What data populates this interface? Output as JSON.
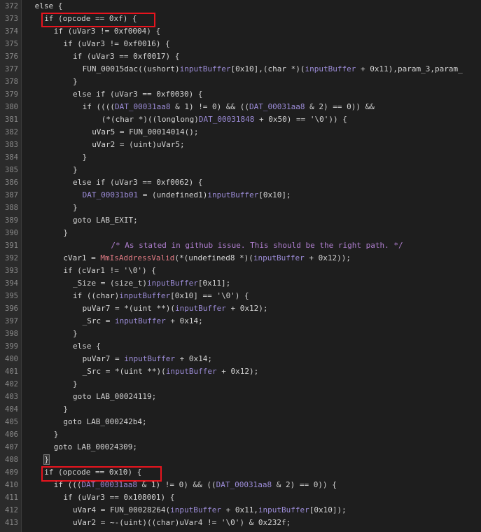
{
  "editor": {
    "lines": [
      {
        "n": "372",
        "i": 1,
        "t": [
          [
            "k",
            "else"
          ],
          [
            "p",
            " {"
          ]
        ]
      },
      {
        "n": "373",
        "i": 2,
        "t": [
          [
            "k",
            "if"
          ],
          [
            "p",
            " (opcode == 0xf) {"
          ]
        ],
        "box": "box1"
      },
      {
        "n": "374",
        "i": 3,
        "t": [
          [
            "k",
            "if"
          ],
          [
            "p",
            " (uVar3 != 0xf0004) {"
          ]
        ]
      },
      {
        "n": "375",
        "i": 4,
        "t": [
          [
            "k",
            "if"
          ],
          [
            "p",
            " (uVar3 != 0xf0016) {"
          ]
        ]
      },
      {
        "n": "376",
        "i": 5,
        "t": [
          [
            "k",
            "if"
          ],
          [
            "p",
            " (uVar3 == 0xf0017) {"
          ]
        ]
      },
      {
        "n": "377",
        "i": 6,
        "t": [
          [
            "f",
            "FUN_00015dac"
          ],
          [
            "p",
            "((ushort)"
          ],
          [
            "gl",
            "inputBuffer"
          ],
          [
            "p",
            "[0x10],(char *)("
          ],
          [
            "gl",
            "inputBuffer"
          ],
          [
            "p",
            " + 0x11),param_3,param_"
          ]
        ]
      },
      {
        "n": "378",
        "i": 5,
        "t": [
          [
            "p",
            "}"
          ]
        ]
      },
      {
        "n": "379",
        "i": 5,
        "t": [
          [
            "k",
            "else if"
          ],
          [
            "p",
            " (uVar3 == 0xf0030) {"
          ]
        ]
      },
      {
        "n": "380",
        "i": 6,
        "t": [
          [
            "k",
            "if"
          ],
          [
            "p",
            " (((("
          ],
          [
            "gl",
            "DAT_00031aa8"
          ],
          [
            "p",
            " & 1) != 0) && (("
          ],
          [
            "gl",
            "DAT_00031aa8"
          ],
          [
            "p",
            " & 2) == 0)) &&"
          ]
        ]
      },
      {
        "n": "381",
        "i": 8,
        "t": [
          [
            "p",
            "(*(char *)((longlong)"
          ],
          [
            "gl",
            "DAT_00031848"
          ],
          [
            "p",
            " + 0x50) == '\\0')) {"
          ]
        ]
      },
      {
        "n": "382",
        "i": 7,
        "t": [
          [
            "p",
            "uVar5 = "
          ],
          [
            "f",
            "FUN_00014014"
          ],
          [
            "p",
            "();"
          ]
        ]
      },
      {
        "n": "383",
        "i": 7,
        "t": [
          [
            "p",
            "uVar2 = (uint)uVar5;"
          ]
        ]
      },
      {
        "n": "384",
        "i": 6,
        "t": [
          [
            "p",
            "}"
          ]
        ]
      },
      {
        "n": "385",
        "i": 5,
        "t": [
          [
            "p",
            "}"
          ]
        ]
      },
      {
        "n": "386",
        "i": 5,
        "t": [
          [
            "k",
            "else if"
          ],
          [
            "p",
            " (uVar3 == 0xf0062) {"
          ]
        ]
      },
      {
        "n": "387",
        "i": 6,
        "t": [
          [
            "gl",
            "DAT_00031b01"
          ],
          [
            "p",
            " = (undefined1)"
          ],
          [
            "gl",
            "inputBuffer"
          ],
          [
            "p",
            "[0x10];"
          ]
        ]
      },
      {
        "n": "388",
        "i": 5,
        "t": [
          [
            "p",
            "}"
          ]
        ]
      },
      {
        "n": "389",
        "i": 5,
        "t": [
          [
            "k",
            "goto"
          ],
          [
            "p",
            " LAB_EXIT;"
          ]
        ]
      },
      {
        "n": "390",
        "i": 4,
        "t": [
          [
            "p",
            "}"
          ]
        ]
      },
      {
        "n": "391",
        "i": 9,
        "t": [
          [
            "cm",
            "/* As stated in github issue. This should be the right path. */"
          ]
        ]
      },
      {
        "n": "392",
        "i": 4,
        "t": [
          [
            "p",
            "cVar1 = "
          ],
          [
            "api",
            "MmIsAddressValid"
          ],
          [
            "p",
            "(*(undefined8 *)("
          ],
          [
            "gl",
            "inputBuffer"
          ],
          [
            "p",
            " + 0x12));"
          ]
        ]
      },
      {
        "n": "393",
        "i": 4,
        "t": [
          [
            "k",
            "if"
          ],
          [
            "p",
            " (cVar1 != '\\0') {"
          ]
        ]
      },
      {
        "n": "394",
        "i": 5,
        "t": [
          [
            "p",
            "_Size = (size_t)"
          ],
          [
            "gl",
            "inputBuffer"
          ],
          [
            "p",
            "[0x11];"
          ]
        ]
      },
      {
        "n": "395",
        "i": 5,
        "t": [
          [
            "k",
            "if"
          ],
          [
            "p",
            " ((char)"
          ],
          [
            "gl",
            "inputBuffer"
          ],
          [
            "p",
            "[0x10] == '\\0') {"
          ]
        ]
      },
      {
        "n": "396",
        "i": 6,
        "t": [
          [
            "p",
            "puVar7 = *(uint **)("
          ],
          [
            "gl",
            "inputBuffer"
          ],
          [
            "p",
            " + 0x12);"
          ]
        ]
      },
      {
        "n": "397",
        "i": 6,
        "t": [
          [
            "p",
            "_Src = "
          ],
          [
            "gl",
            "inputBuffer"
          ],
          [
            "p",
            " + 0x14;"
          ]
        ]
      },
      {
        "n": "398",
        "i": 5,
        "t": [
          [
            "p",
            "}"
          ]
        ]
      },
      {
        "n": "399",
        "i": 5,
        "t": [
          [
            "k",
            "else"
          ],
          [
            "p",
            " {"
          ]
        ]
      },
      {
        "n": "400",
        "i": 6,
        "t": [
          [
            "p",
            "puVar7 = "
          ],
          [
            "gl",
            "inputBuffer"
          ],
          [
            "p",
            " + 0x14;"
          ]
        ]
      },
      {
        "n": "401",
        "i": 6,
        "t": [
          [
            "p",
            "_Src = *(uint **)("
          ],
          [
            "gl",
            "inputBuffer"
          ],
          [
            "p",
            " + 0x12);"
          ]
        ]
      },
      {
        "n": "402",
        "i": 5,
        "t": [
          [
            "p",
            "}"
          ]
        ]
      },
      {
        "n": "403",
        "i": 5,
        "t": [
          [
            "k",
            "goto"
          ],
          [
            "p",
            " LAB_00024119;"
          ]
        ]
      },
      {
        "n": "404",
        "i": 4,
        "t": [
          [
            "p",
            "}"
          ]
        ]
      },
      {
        "n": "405",
        "i": 4,
        "t": [
          [
            "k",
            "goto"
          ],
          [
            "p",
            " LAB_000242b4;"
          ]
        ]
      },
      {
        "n": "406",
        "i": 3,
        "t": [
          [
            "p",
            "}"
          ]
        ]
      },
      {
        "n": "407",
        "i": 3,
        "t": [
          [
            "k",
            "goto"
          ],
          [
            "p",
            " LAB_00024309;"
          ]
        ]
      },
      {
        "n": "408",
        "i": 2,
        "t": [
          [
            "c",
            "}"
          ]
        ]
      },
      {
        "n": "409",
        "i": 2,
        "t": [
          [
            "k",
            "if"
          ],
          [
            "p",
            " (opcode == 0x10) {"
          ]
        ],
        "box": "box2"
      },
      {
        "n": "410",
        "i": 3,
        "t": [
          [
            "k",
            "if"
          ],
          [
            "p",
            " ((("
          ],
          [
            "gl",
            "DAT_00031aa8"
          ],
          [
            "p",
            " & 1) != 0) && (("
          ],
          [
            "gl",
            "DAT_00031aa8"
          ],
          [
            "p",
            " & 2) == 0)) {"
          ]
        ]
      },
      {
        "n": "411",
        "i": 4,
        "t": [
          [
            "k",
            "if"
          ],
          [
            "p",
            " (uVar3 == 0x108001) {"
          ]
        ]
      },
      {
        "n": "412",
        "i": 5,
        "t": [
          [
            "p",
            "uVar4 = "
          ],
          [
            "f",
            "FUN_00028264"
          ],
          [
            "p",
            "("
          ],
          [
            "gl",
            "inputBuffer"
          ],
          [
            "p",
            " + 0x11,"
          ],
          [
            "gl",
            "inputBuffer"
          ],
          [
            "p",
            "[0x10]);"
          ]
        ]
      },
      {
        "n": "413",
        "i": 5,
        "t": [
          [
            "p",
            "uVar2 = ~-(uint)((char)uVar4 != '\\0') & 0x232f;"
          ]
        ]
      }
    ]
  },
  "colors": {
    "background": "#1e1e1e",
    "global_var": "#9b8bd6",
    "api_call": "#e27b84",
    "comment": "#b07fd0",
    "highlight_box": "#e8141e"
  }
}
